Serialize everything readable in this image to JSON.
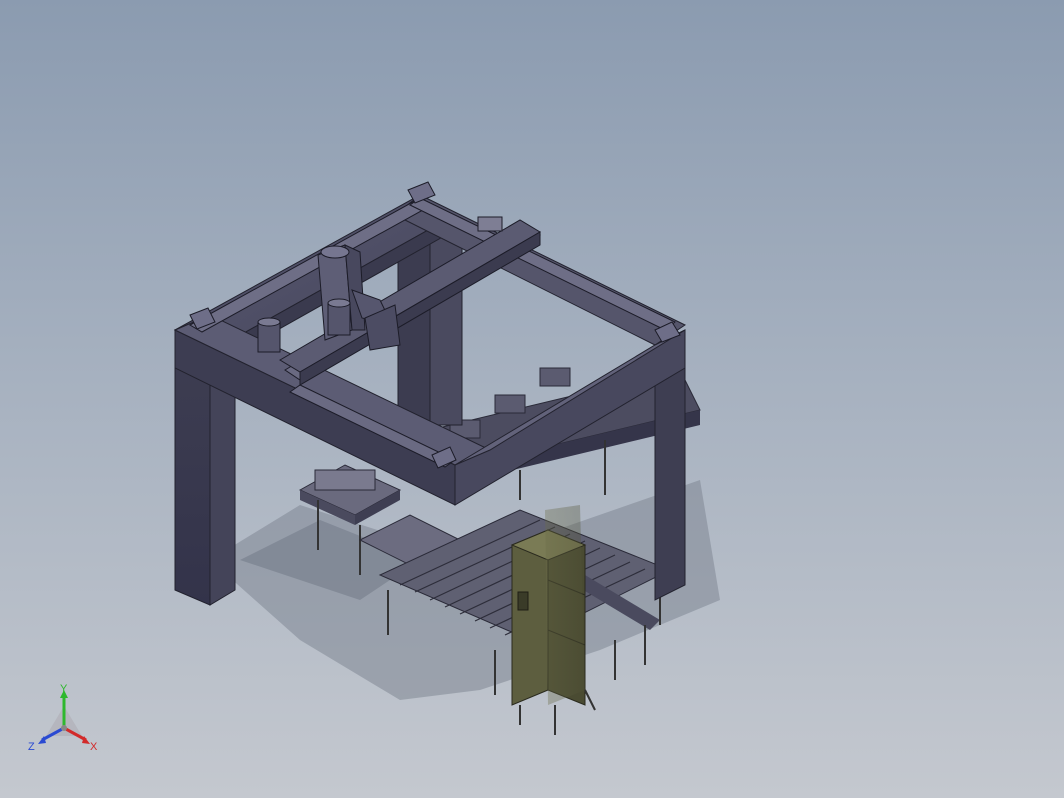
{
  "viewport": {
    "background_top": "#8b9bb0",
    "background_bottom": "#c4c8cf",
    "model_color": "#4a4a5e",
    "enclosure_color": "#5d5e3f"
  },
  "triad": {
    "y_label": "Y",
    "x_label": "X",
    "z_label": "Z",
    "x_color": "#d22a2a",
    "y_color": "#2eb82e",
    "z_color": "#2a4ad2"
  }
}
